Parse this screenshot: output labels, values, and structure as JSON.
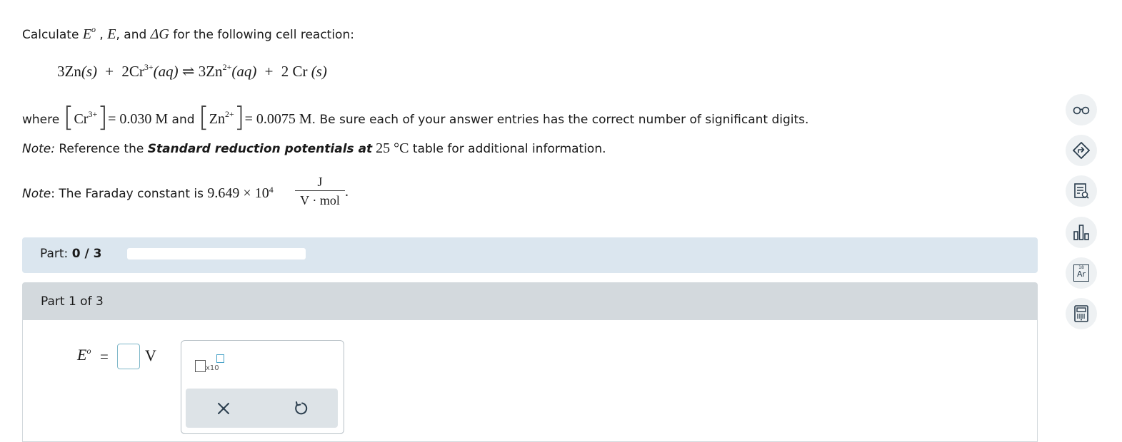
{
  "question": {
    "calc_prefix": "Calculate ",
    "sym_E0_base": "E",
    "sym_E0_sup": "o",
    "sep1": " , ",
    "sym_E": "E",
    "sep2": ", and ",
    "sym_dG": "ΔG",
    "calc_suffix": " for the following cell reaction:",
    "reaction": {
      "r1": "3Zn",
      "r1_state": "(s)",
      "plus1": "+",
      "r2": "2Cr",
      "r2_charge": "3+",
      "r2_state": "(aq)",
      "arrow": "⇌",
      "p1": "3Zn",
      "p1_charge": "2+",
      "p1_state": "(aq)",
      "plus2": "+",
      "p2": "2 Cr",
      "p2_state": "(s)"
    },
    "where_label": "where",
    "cr_ion": "Cr",
    "cr_charge": "3+",
    "cr_value": "= 0.030 M",
    "and_label": "and",
    "zn_ion": "Zn",
    "zn_charge": "2+",
    "zn_value": "= 0.0075 M",
    "sigfig_text": ". Be sure each of your answer entries has the correct number of significant digits.",
    "note1_label": "Note:",
    "note1_pre": " Reference the ",
    "note1_bold": "Standard reduction potentials at",
    "note1_temp": " 25 °C",
    "note1_post": " table for additional information.",
    "note2_label": "Note",
    "note2_pre": ": The Faraday constant is ",
    "faraday_mantissa": "9.649 × 10",
    "faraday_exp": "4",
    "faraday_num": "J",
    "faraday_den": "V · mol",
    "faraday_end": "."
  },
  "progress": {
    "label": "Part:",
    "value": "0 / 3",
    "fraction": 0
  },
  "part": {
    "header": "Part 1 of 3",
    "answer_symbol": "E",
    "answer_symbol_sup": "o",
    "equals": "=",
    "unit": "V",
    "x10_label": "x10"
  },
  "sidebar_icons": [
    "glasses-icon",
    "navigate-icon",
    "notes-icon",
    "bar-chart-icon",
    "periodic-table-icon",
    "calculator-icon"
  ],
  "periodic_table": {
    "number": "18",
    "symbol": "Ar"
  },
  "colors": {
    "accent": "#4aa3c8",
    "part_bar": "#dbe6ef",
    "part_header": "#d3d9dd",
    "icon": "#2a3d4d"
  }
}
